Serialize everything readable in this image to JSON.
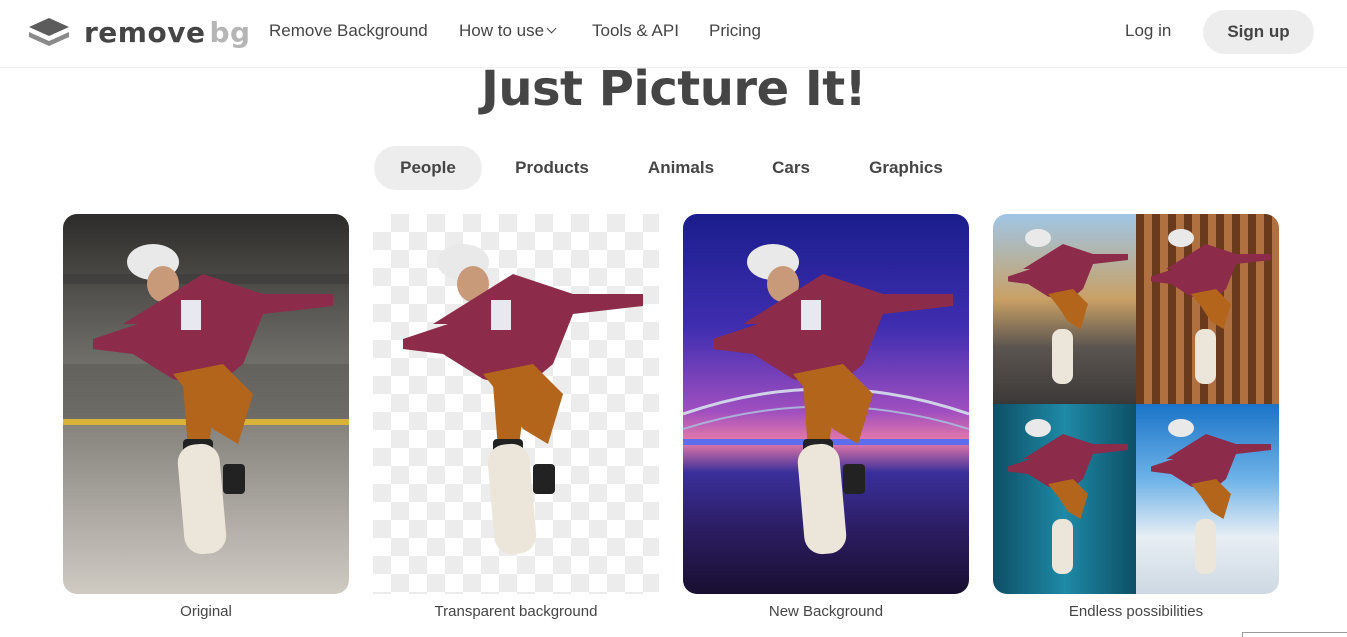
{
  "brand": {
    "name_part1": "remove",
    "name_part2": "bg",
    "colors": {
      "primary_text": "#454545",
      "muted_text": "#b5b5b5",
      "pill_bg": "#ededed"
    }
  },
  "nav": {
    "links": [
      "Remove Background",
      "How to use",
      "Tools & API",
      "Pricing"
    ],
    "login": "Log in",
    "signup": "Sign up"
  },
  "hero": {
    "title": "Just Picture It!"
  },
  "tabs": {
    "items": [
      "People",
      "Products",
      "Animals",
      "Cars",
      "Graphics"
    ],
    "active": "People"
  },
  "cards": {
    "captions": [
      "Original",
      "Transparent background",
      "New Background",
      "Endless possibilities"
    ]
  }
}
